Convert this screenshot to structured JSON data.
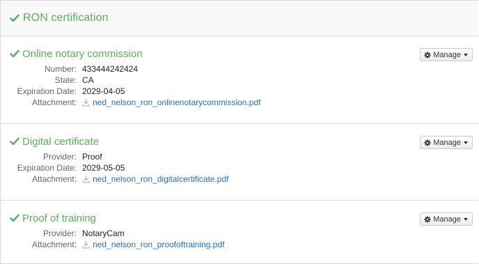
{
  "header": {
    "title": "RON certification"
  },
  "sections": [
    {
      "title": "Online notary commission",
      "manage_label": "Manage",
      "fields": [
        {
          "label": "Number:",
          "value": "433444242424"
        },
        {
          "label": "State:",
          "value": "CA"
        },
        {
          "label": "Expiration Date:",
          "value": "2029-04-05"
        }
      ],
      "attachment_label": "Attachment:",
      "attachment": "ned_nelson_ron_onlinenotarycommission.pdf"
    },
    {
      "title": "Digital certificate",
      "manage_label": "Manage",
      "fields": [
        {
          "label": "Provider:",
          "value": "Proof"
        },
        {
          "label": "Expiration Date:",
          "value": "2029-05-05"
        }
      ],
      "attachment_label": "Attachment:",
      "attachment": "ned_nelson_ron_digitalcertificate.pdf"
    },
    {
      "title": "Proof of training",
      "manage_label": "Manage",
      "fields": [
        {
          "label": "Provider:",
          "value": "NotaryCam"
        }
      ],
      "attachment_label": "Attachment:",
      "attachment": "ned_nelson_ron_proofoftraining.pdf"
    }
  ],
  "colors": {
    "accent_green": "#5cae5c",
    "link_blue": "#2a6ebb"
  },
  "icons": {
    "section_status": "check-icon",
    "manage": "gear-icon",
    "attachment": "download-icon"
  }
}
